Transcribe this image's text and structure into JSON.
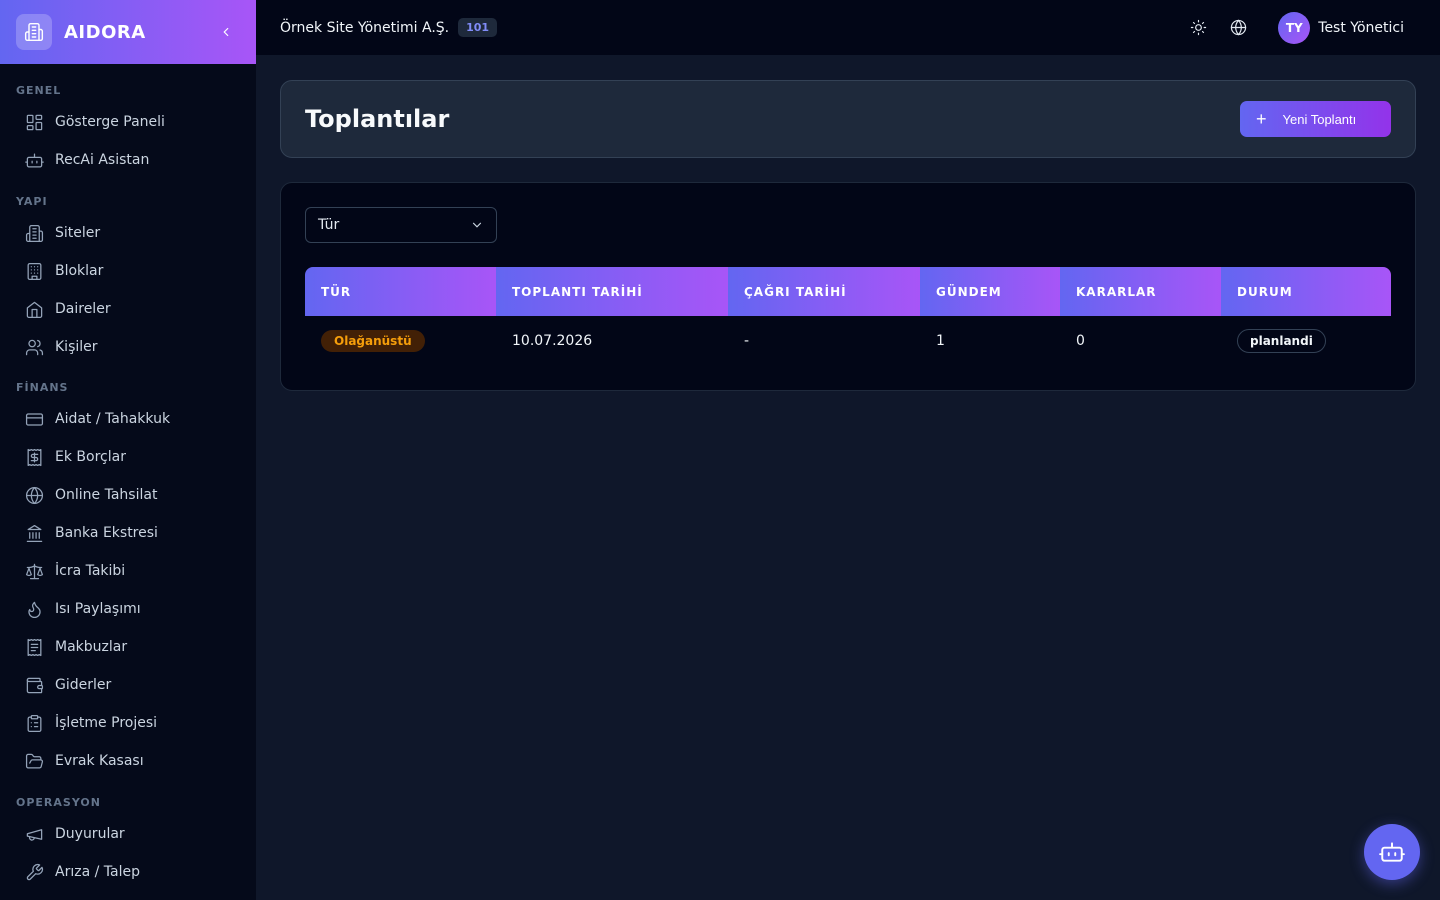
{
  "app": {
    "name": "AIDORA"
  },
  "sidebar": {
    "sections": [
      {
        "title": "GENEL",
        "items": [
          {
            "label": "Gösterge Paneli",
            "icon": "dashboard-icon"
          },
          {
            "label": "RecAi Asistan",
            "icon": "bot-icon"
          }
        ]
      },
      {
        "title": "YAPI",
        "items": [
          {
            "label": "Siteler",
            "icon": "building-icon"
          },
          {
            "label": "Bloklar",
            "icon": "block-icon"
          },
          {
            "label": "Daireler",
            "icon": "home-icon"
          },
          {
            "label": "Kişiler",
            "icon": "users-icon"
          }
        ]
      },
      {
        "title": "FİNANS",
        "items": [
          {
            "label": "Aidat / Tahakkuk",
            "icon": "credit-card-icon"
          },
          {
            "label": "Ek Borçlar",
            "icon": "dollar-receipt-icon"
          },
          {
            "label": "Online Tahsilat",
            "icon": "globe-icon"
          },
          {
            "label": "Banka Ekstresi",
            "icon": "bank-icon"
          },
          {
            "label": "İcra Takibi",
            "icon": "scale-icon"
          },
          {
            "label": "Isı Paylaşımı",
            "icon": "flame-icon"
          },
          {
            "label": "Makbuzlar",
            "icon": "receipt-icon"
          },
          {
            "label": "Giderler",
            "icon": "wallet-icon"
          },
          {
            "label": "İşletme Projesi",
            "icon": "clipboard-icon"
          },
          {
            "label": "Evrak Kasası",
            "icon": "folder-open-icon"
          }
        ]
      },
      {
        "title": "OPERASYON",
        "items": [
          {
            "label": "Duyurular",
            "icon": "megaphone-icon"
          },
          {
            "label": "Arıza / Talep",
            "icon": "wrench-icon"
          }
        ]
      }
    ]
  },
  "topbar": {
    "org_name": "Örnek Site Yönetimi A.Ş.",
    "org_badge": "101",
    "user_initials": "TY",
    "user_name": "Test Yönetici"
  },
  "page": {
    "title": "Toplantılar",
    "new_button": "Yeni Toplantı",
    "new_button_icon": "+",
    "filter_label": "Tür"
  },
  "table": {
    "columns": [
      "TÜR",
      "TOPLANTI TARİHİ",
      "ÇAĞRI TARİHİ",
      "GÜNDEM",
      "KARARLAR",
      "DURUM"
    ],
    "rows": [
      {
        "type": "Olağanüstü",
        "meeting_date": "10.07.2026",
        "call_date": "-",
        "agenda": "1",
        "decisions": "0",
        "status": "planlandi"
      }
    ]
  },
  "colors": {
    "accent_start": "#6366f1",
    "accent_end": "#a855f7",
    "warning": "#f59e0b"
  }
}
